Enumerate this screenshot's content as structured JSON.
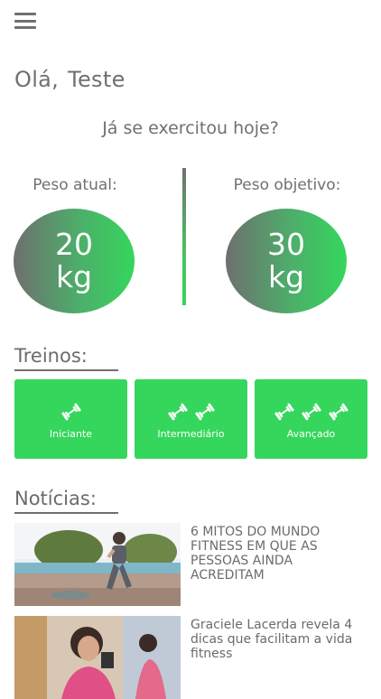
{
  "header": {
    "menu_icon": "hamburger-menu-icon"
  },
  "greeting": {
    "hello": "Olá,",
    "name": "Teste"
  },
  "question": "Já se exercitou hoje?",
  "weights": {
    "current": {
      "label": "Peso atual:",
      "value": "20",
      "unit": "kg"
    },
    "target": {
      "label": "Peso objetivo:",
      "value": "30",
      "unit": "kg"
    }
  },
  "colors": {
    "accent": "#35d65c",
    "gray": "#707070"
  },
  "trainings": {
    "title": "Treinos:",
    "items": [
      {
        "label": "Iniciante",
        "icon": "dumbbell-icon",
        "icon_count": 1
      },
      {
        "label": "Intermediário",
        "icon": "dumbbell-icon",
        "icon_count": 2
      },
      {
        "label": "Avançado",
        "icon": "dumbbell-icon",
        "icon_count": 3
      }
    ]
  },
  "news": {
    "title": "Notícias:",
    "items": [
      {
        "title": "6 MITOS DO MUNDO FITNESS EM QUE AS PESSOAS AINDA ACREDITAM",
        "image": "woman-exercising-outdoors-photo"
      },
      {
        "title": "Graciele Lacerda revela 4 dicas que facilitam a vida fitness",
        "image": "woman-at-gym-photo"
      }
    ]
  }
}
